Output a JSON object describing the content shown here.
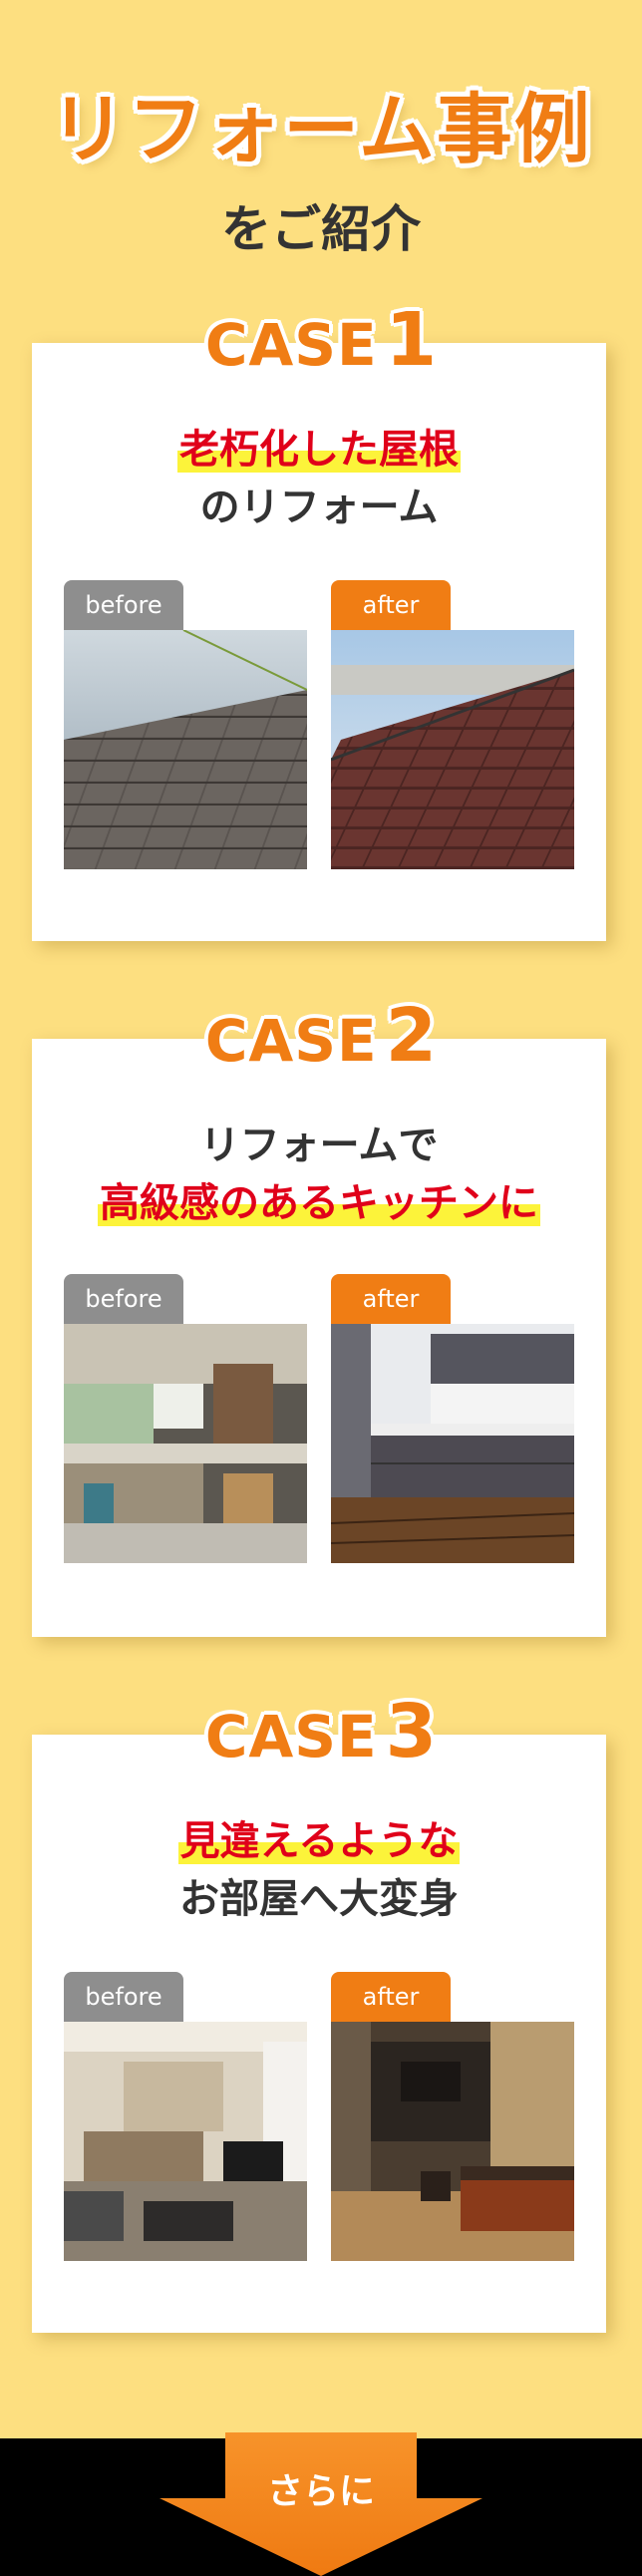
{
  "header": {
    "title": "リフォーム事例",
    "subtitle": "をご紹介"
  },
  "cases": [
    {
      "label_word": "CASE",
      "label_num": "1",
      "heading_highlight": "老朽化した屋根",
      "heading_plain": "のリフォーム",
      "before_label": "before",
      "after_label": "after"
    },
    {
      "label_word": "CASE",
      "label_num": "2",
      "heading_plain": "リフォームで",
      "heading_highlight": "高級感のあるキッチンに",
      "before_label": "before",
      "after_label": "after"
    },
    {
      "label_word": "CASE",
      "label_num": "3",
      "heading_highlight": "見違えるような",
      "heading_plain": "お部屋へ大変身",
      "before_label": "before",
      "after_label": "after"
    }
  ],
  "footer": {
    "more_label": "さらに"
  },
  "colors": {
    "background": "#fddf80",
    "accent_orange": "#f07d14",
    "highlight_red": "#e0001a",
    "highlight_yellow": "#fcf33a",
    "before_tag": "#8e8e8e"
  }
}
